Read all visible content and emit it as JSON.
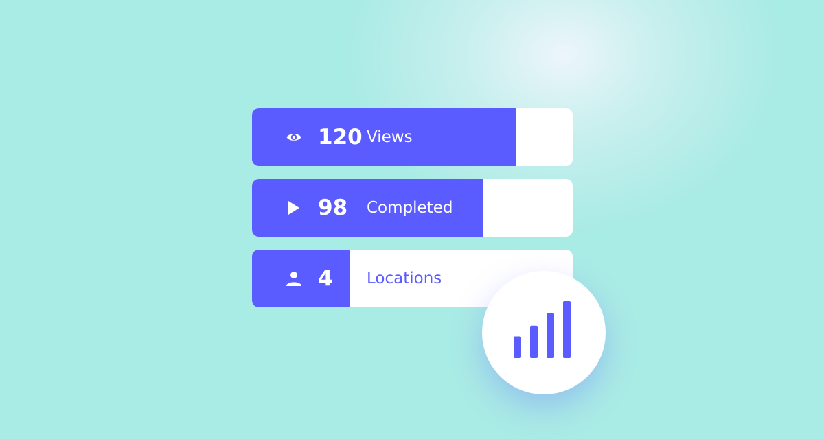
{
  "colors": {
    "accent": "#5b5cff",
    "background": "#a9ebe5",
    "card": "#ffffff"
  },
  "stats": [
    {
      "icon": "eye-icon",
      "value": "120",
      "label": "Views",
      "fill": 0.824
    },
    {
      "icon": "play-icon",
      "value": "98",
      "label": "Completed",
      "fill": 0.719
    },
    {
      "icon": "user-icon",
      "value": "4",
      "label": "Locations",
      "fill": 0.306
    }
  ],
  "badge": {
    "icon": "bar-chart-icon",
    "bars": [
      0.38,
      0.57,
      0.79,
      1.0
    ]
  }
}
